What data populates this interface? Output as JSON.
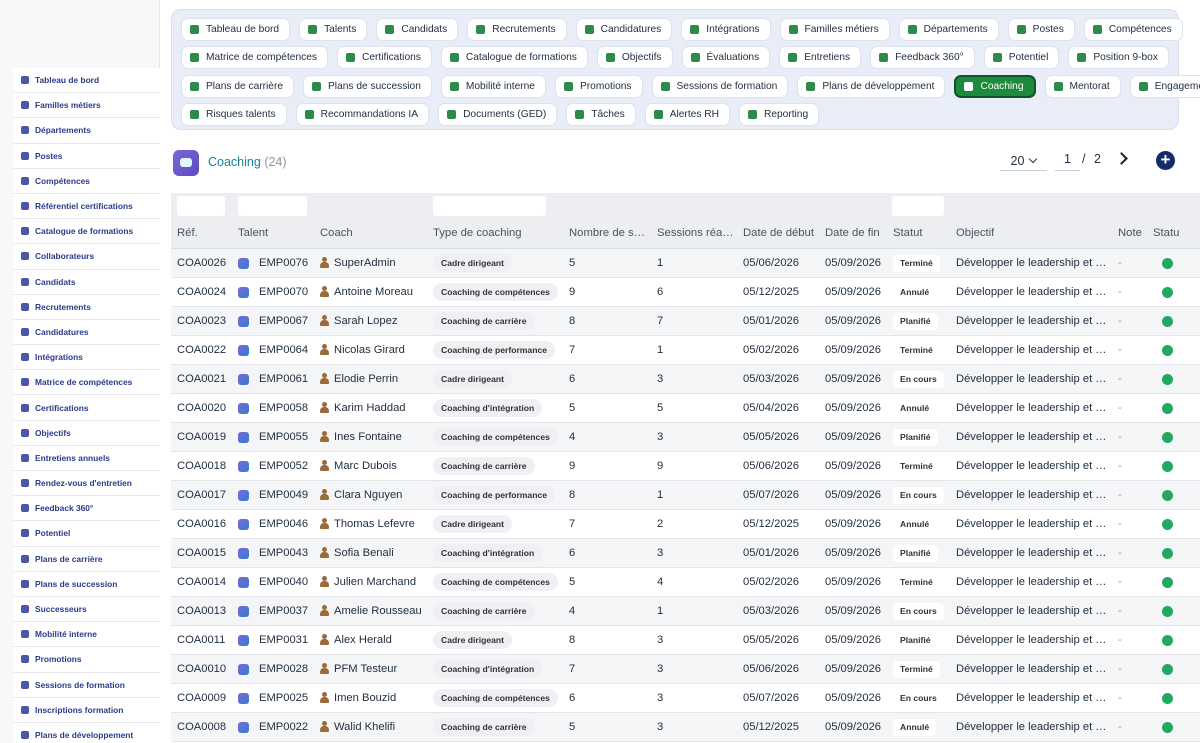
{
  "sidebar": {
    "items": [
      {
        "label": "Tableau de bord",
        "icon": "dashboard-icon"
      },
      {
        "label": "Familles métiers",
        "icon": "hierarchy-icon"
      },
      {
        "label": "Départements",
        "icon": "building-icon"
      },
      {
        "label": "Postes",
        "icon": "badge-icon"
      },
      {
        "label": "Compétences",
        "icon": "brain-icon"
      },
      {
        "label": "Référentiel certifications",
        "icon": "certificate-icon"
      },
      {
        "label": "Catalogue de formations",
        "icon": "graduation-cap-icon"
      },
      {
        "label": "Collaborateurs",
        "icon": "user-icon"
      },
      {
        "label": "Candidats",
        "icon": "user-plus-icon"
      },
      {
        "label": "Recrutements",
        "icon": "megaphone-icon"
      },
      {
        "label": "Candidatures",
        "icon": "file-signature-icon"
      },
      {
        "label": "Intégrations",
        "icon": "door-icon"
      },
      {
        "label": "Matrice de compétences",
        "icon": "network-icon"
      },
      {
        "label": "Certifications",
        "icon": "award-icon"
      },
      {
        "label": "Objectifs",
        "icon": "target-icon"
      },
      {
        "label": "Entretiens annuels",
        "icon": "star-icon"
      },
      {
        "label": "Rendez-vous d'entretien",
        "icon": "comments-icon"
      },
      {
        "label": "Feedback 360°",
        "icon": "comment-icon"
      },
      {
        "label": "Potentiel",
        "icon": "chart-line-icon"
      },
      {
        "label": "Plans de carrière",
        "icon": "road-icon"
      },
      {
        "label": "Plans de succession",
        "icon": "sitemap-icon"
      },
      {
        "label": "Successeurs",
        "icon": "users-icon"
      },
      {
        "label": "Mobilité interne",
        "icon": "exchange-icon"
      },
      {
        "label": "Promotions",
        "icon": "arrow-up-icon"
      },
      {
        "label": "Sessions de formation",
        "icon": "chalkboard-icon"
      },
      {
        "label": "Inscriptions formation",
        "icon": "user-check-icon"
      },
      {
        "label": "Plans de développement",
        "icon": "clipboard-icon"
      }
    ]
  },
  "tabs": {
    "rows": [
      [
        {
          "label": "Tableau de bord",
          "icon": "dashboard-icon"
        },
        {
          "label": "Talents",
          "icon": "user-tie-icon"
        },
        {
          "label": "Candidats",
          "icon": "user-plus-icon"
        },
        {
          "label": "Recrutements",
          "icon": "megaphone-icon"
        },
        {
          "label": "Candidatures",
          "icon": "file-signature-icon"
        },
        {
          "label": "Intégrations",
          "icon": "door-icon"
        },
        {
          "label": "Familles métiers",
          "icon": "hierarchy-icon"
        },
        {
          "label": "Départements",
          "icon": "building-icon"
        },
        {
          "label": "Postes",
          "icon": "badge-icon"
        },
        {
          "label": "Compétences",
          "icon": "brain-icon"
        }
      ],
      [
        {
          "label": "Matrice de compétences",
          "icon": "network-icon"
        },
        {
          "label": "Certifications",
          "icon": "award-icon"
        },
        {
          "label": "Catalogue de formations",
          "icon": "graduation-cap-icon"
        },
        {
          "label": "Objectifs",
          "icon": "target-icon"
        },
        {
          "label": "Évaluations",
          "icon": "star-icon"
        },
        {
          "label": "Entretiens",
          "icon": "comments-icon"
        },
        {
          "label": "Feedback 360°",
          "icon": "comment-icon"
        },
        {
          "label": "Potentiel",
          "icon": "chart-line-icon"
        },
        {
          "label": "Position 9-box",
          "icon": "grid-icon"
        }
      ],
      [
        {
          "label": "Plans de carrière",
          "icon": "road-icon"
        },
        {
          "label": "Plans de succession",
          "icon": "sitemap-icon"
        },
        {
          "label": "Mobilité interne",
          "icon": "exchange-icon"
        },
        {
          "label": "Promotions",
          "icon": "arrow-up-icon"
        },
        {
          "label": "Sessions de formation",
          "icon": "chalkboard-icon"
        },
        {
          "label": "Plans de développement",
          "icon": "clipboard-icon"
        },
        {
          "label": "Coaching",
          "icon": "hands-helping-icon",
          "active": true
        },
        {
          "label": "Mentorat",
          "icon": "chalkboard-teacher-icon"
        },
        {
          "label": "Engagement",
          "icon": "heart-icon"
        }
      ],
      [
        {
          "label": "Risques talents",
          "icon": "warning-icon"
        },
        {
          "label": "Recommandations IA",
          "icon": "robot-icon"
        },
        {
          "label": "Documents (GED)",
          "icon": "folder-icon"
        },
        {
          "label": "Tâches",
          "icon": "tasks-icon"
        },
        {
          "label": "Alertes RH",
          "icon": "bell-icon"
        },
        {
          "label": "Reporting",
          "icon": "pie-chart-icon"
        }
      ]
    ]
  },
  "header": {
    "title": "Coaching",
    "count": "(24)",
    "page_size": "20",
    "page_current": "1",
    "page_separator": "/",
    "page_total": "2"
  },
  "table": {
    "headers": {
      "ref": "Réf.",
      "talent": "Talent",
      "coach": "Coach",
      "type": "Type de coaching",
      "nb": "Nombre de s…",
      "real": "Sessions réa…",
      "debut": "Date de début",
      "fin": "Date de fin",
      "statut": "Statut",
      "objectif": "Objectif",
      "note": "Note",
      "statut2": "Statu"
    },
    "rows": [
      {
        "ref": "COA0026",
        "talent": "EMP0076",
        "coach": "SuperAdmin",
        "type": "Cadre dirigeant",
        "nb": "5",
        "real": "1",
        "debut": "05/06/2026",
        "fin": "05/09/2026",
        "statut": "Terminé",
        "objectif": "Développer le leadership et …",
        "note": "-"
      },
      {
        "ref": "COA0024",
        "talent": "EMP0070",
        "coach": "Antoine Moreau",
        "type": "Coaching de compétences",
        "nb": "9",
        "real": "6",
        "debut": "05/12/2025",
        "fin": "05/09/2026",
        "statut": "Annulé",
        "objectif": "Développer le leadership et …",
        "note": "-"
      },
      {
        "ref": "COA0023",
        "talent": "EMP0067",
        "coach": "Sarah Lopez",
        "type": "Coaching de carrière",
        "nb": "8",
        "real": "7",
        "debut": "05/01/2026",
        "fin": "05/09/2026",
        "statut": "Planifié",
        "objectif": "Développer le leadership et …",
        "note": "-"
      },
      {
        "ref": "COA0022",
        "talent": "EMP0064",
        "coach": "Nicolas Girard",
        "type": "Coaching de performance",
        "nb": "7",
        "real": "1",
        "debut": "05/02/2026",
        "fin": "05/09/2026",
        "statut": "Terminé",
        "objectif": "Développer le leadership et …",
        "note": "-"
      },
      {
        "ref": "COA0021",
        "talent": "EMP0061",
        "coach": "Elodie Perrin",
        "type": "Cadre dirigeant",
        "nb": "6",
        "real": "3",
        "debut": "05/03/2026",
        "fin": "05/09/2026",
        "statut": "En cours",
        "objectif": "Développer le leadership et …",
        "note": "-"
      },
      {
        "ref": "COA0020",
        "talent": "EMP0058",
        "coach": "Karim Haddad",
        "type": "Coaching d'intégration",
        "nb": "5",
        "real": "5",
        "debut": "05/04/2026",
        "fin": "05/09/2026",
        "statut": "Annulé",
        "objectif": "Développer le leadership et …",
        "note": "-"
      },
      {
        "ref": "COA0019",
        "talent": "EMP0055",
        "coach": "Ines Fontaine",
        "type": "Coaching de compétences",
        "nb": "4",
        "real": "3",
        "debut": "05/05/2026",
        "fin": "05/09/2026",
        "statut": "Planifié",
        "objectif": "Développer le leadership et …",
        "note": "-"
      },
      {
        "ref": "COA0018",
        "talent": "EMP0052",
        "coach": "Marc Dubois",
        "type": "Coaching de carrière",
        "nb": "9",
        "real": "9",
        "debut": "05/06/2026",
        "fin": "05/09/2026",
        "statut": "Terminé",
        "objectif": "Développer le leadership et …",
        "note": "-"
      },
      {
        "ref": "COA0017",
        "talent": "EMP0049",
        "coach": "Clara Nguyen",
        "type": "Coaching de performance",
        "nb": "8",
        "real": "1",
        "debut": "05/07/2026",
        "fin": "05/09/2026",
        "statut": "En cours",
        "objectif": "Développer le leadership et …",
        "note": "-"
      },
      {
        "ref": "COA0016",
        "talent": "EMP0046",
        "coach": "Thomas Lefevre",
        "type": "Cadre dirigeant",
        "nb": "7",
        "real": "2",
        "debut": "05/12/2025",
        "fin": "05/09/2026",
        "statut": "Annulé",
        "objectif": "Développer le leadership et …",
        "note": "-"
      },
      {
        "ref": "COA0015",
        "talent": "EMP0043",
        "coach": "Sofia Benali",
        "type": "Coaching d'intégration",
        "nb": "6",
        "real": "3",
        "debut": "05/01/2026",
        "fin": "05/09/2026",
        "statut": "Planifié",
        "objectif": "Développer le leadership et …",
        "note": "-"
      },
      {
        "ref": "COA0014",
        "talent": "EMP0040",
        "coach": "Julien Marchand",
        "type": "Coaching de compétences",
        "nb": "5",
        "real": "4",
        "debut": "05/02/2026",
        "fin": "05/09/2026",
        "statut": "Terminé",
        "objectif": "Développer le leadership et …",
        "note": "-"
      },
      {
        "ref": "COA0013",
        "talent": "EMP0037",
        "coach": "Amelie Rousseau",
        "type": "Coaching de carrière",
        "nb": "4",
        "real": "1",
        "debut": "05/03/2026",
        "fin": "05/09/2026",
        "statut": "En cours",
        "objectif": "Développer le leadership et …",
        "note": "-"
      },
      {
        "ref": "COA0011",
        "talent": "EMP0031",
        "coach": "Alex Herald",
        "type": "Cadre dirigeant",
        "nb": "8",
        "real": "3",
        "debut": "05/05/2026",
        "fin": "05/09/2026",
        "statut": "Planifié",
        "objectif": "Développer le leadership et …",
        "note": "-"
      },
      {
        "ref": "COA0010",
        "talent": "EMP0028",
        "coach": "PFM Testeur",
        "type": "Coaching d'intégration",
        "nb": "7",
        "real": "3",
        "debut": "05/06/2026",
        "fin": "05/09/2026",
        "statut": "Terminé",
        "objectif": "Développer le leadership et …",
        "note": "-"
      },
      {
        "ref": "COA0009",
        "talent": "EMP0025",
        "coach": "Imen Bouzid",
        "type": "Coaching de compétences",
        "nb": "6",
        "real": "3",
        "debut": "05/07/2026",
        "fin": "05/09/2026",
        "statut": "En cours",
        "objectif": "Développer le leadership et …",
        "note": "-"
      },
      {
        "ref": "COA0008",
        "talent": "EMP0022",
        "coach": "Walid Khelifi",
        "type": "Coaching de carrière",
        "nb": "5",
        "real": "3",
        "debut": "05/12/2025",
        "fin": "05/09/2026",
        "statut": "Annulé",
        "objectif": "Développer le leadership et …",
        "note": "-"
      }
    ]
  },
  "colors": {
    "active_tab": "#1e8a3c",
    "status_dot": "#22a862",
    "add_button": "#152a6b",
    "title": "#1d7ea0"
  }
}
